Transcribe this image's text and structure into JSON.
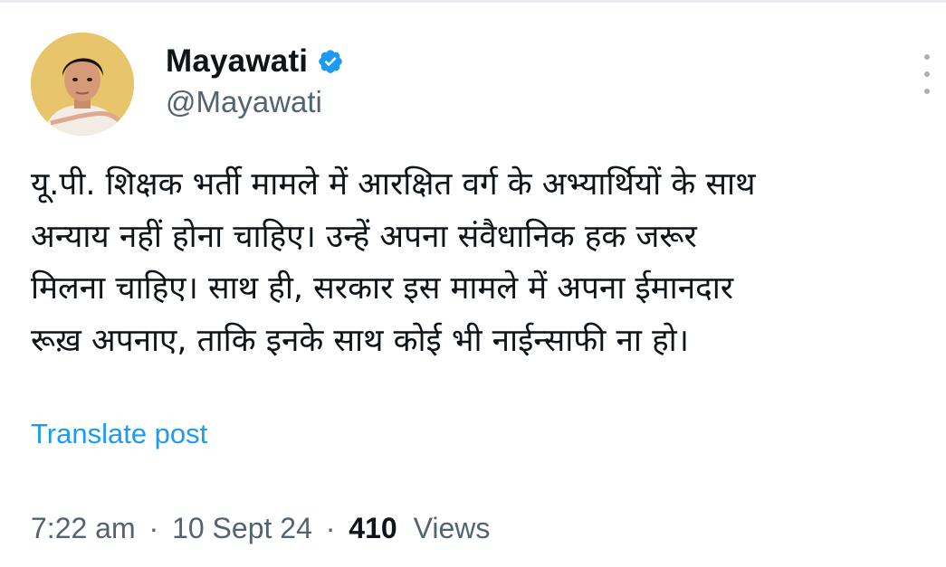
{
  "author": {
    "display_name": "Mayawati",
    "handle": "@Mayawati",
    "verified": true
  },
  "post": {
    "lines": [
      "यू.पी. शिक्षक भर्ती मामले में आरक्षित वर्ग के अभ्यार्थियों के साथ",
      "अन्याय नहीं होना चाहिए। उन्हें अपना संवैधानिक हक जरूर",
      "मिलना चाहिए। साथ ही, सरकार इस मामले में अपना ईमानदार",
      "रूख़ अपनाए, ताकि इनके साथ कोई भी नाईन्साफी ना हो।"
    ],
    "translate_label": "Translate post"
  },
  "meta": {
    "time": "7:22 am",
    "separator": "·",
    "date": "10 Sept 24",
    "views_count": "410",
    "views_label": "Views"
  },
  "colors": {
    "text_primary": "#0f1419",
    "text_secondary": "#536471",
    "accent": "#1d9bf0",
    "avatar_background": "#e8c56a"
  },
  "icons": {
    "verified": "verified-badge-icon",
    "more": "more-vertical-icon"
  }
}
